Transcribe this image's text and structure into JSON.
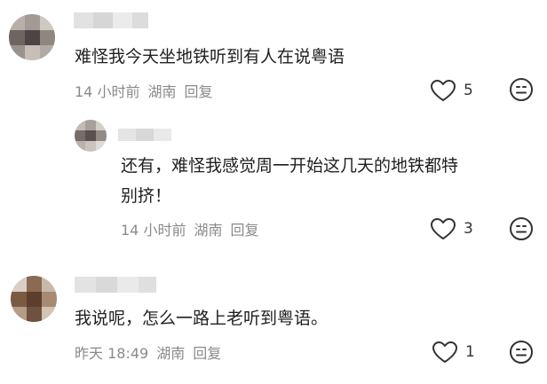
{
  "comments": [
    {
      "text": "难怪我今天坐地铁听到有人在说粤语",
      "time": "14 小时前",
      "location": "湖南",
      "reply_label": "回复",
      "likes": "5"
    },
    {
      "text_line1": "还有，难怪我感觉周一开始这几天的地铁都特",
      "text_line2": "别挤！",
      "time": "14 小时前",
      "location": "湖南",
      "reply_label": "回复",
      "likes": "3"
    },
    {
      "text": "我说呢，怎么一路上老听到粤语。",
      "time": "昨天 18:49",
      "location": "湖南",
      "reply_label": "回复",
      "likes": "1"
    }
  ],
  "icons": {
    "like": "heart-outline-icon",
    "react": "smiley-face-icon"
  },
  "colors": {
    "text": "#1f1f1f",
    "meta": "#8a8a8a",
    "icon": "#333333"
  }
}
